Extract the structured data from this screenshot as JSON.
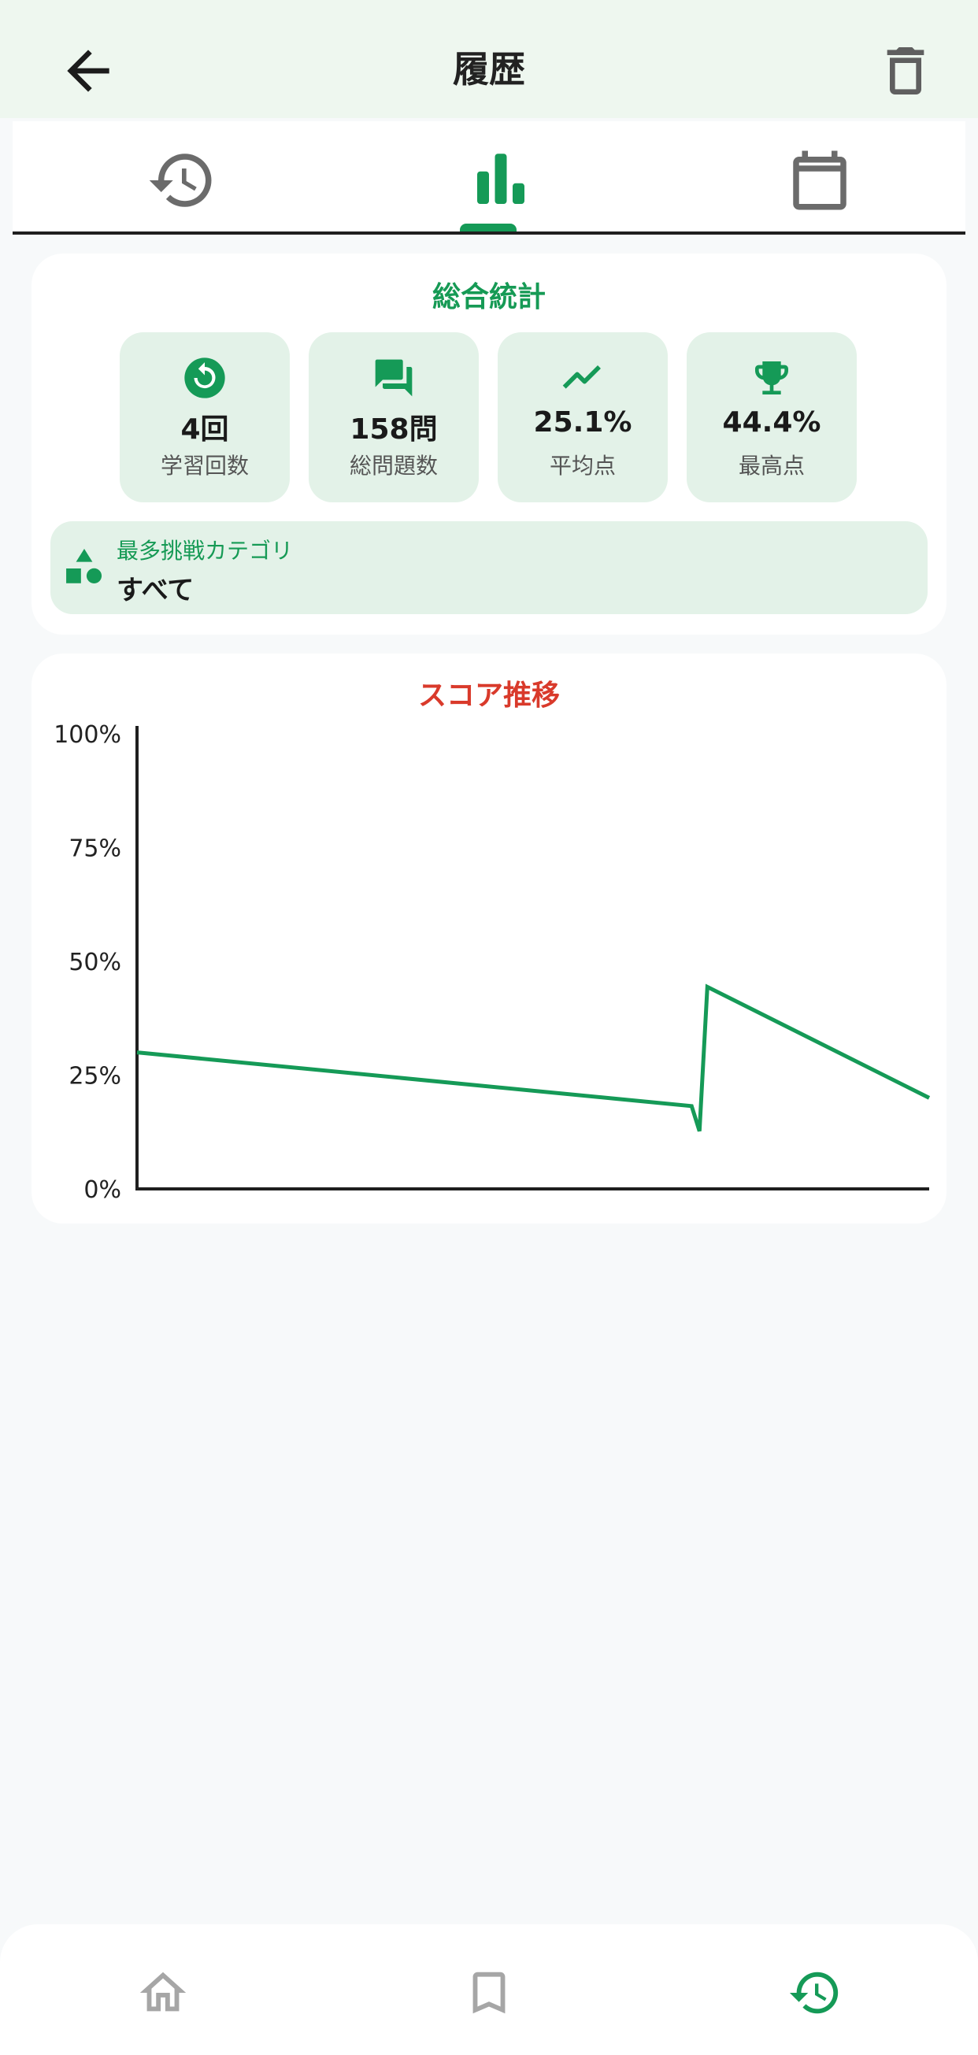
{
  "app_bar": {
    "title": "履歴",
    "back_icon": "arrow-back-icon",
    "delete_icon": "trash-icon"
  },
  "tabs": [
    {
      "name": "history",
      "icon": "history-icon",
      "active": false
    },
    {
      "name": "stats",
      "icon": "bar-chart-icon",
      "active": true
    },
    {
      "name": "calendar",
      "icon": "calendar-icon",
      "active": false
    }
  ],
  "summary": {
    "title": "総合統計",
    "stats": [
      {
        "icon": "replay-icon",
        "value": "4回",
        "label": "学習回数"
      },
      {
        "icon": "forum-icon",
        "value": "158問",
        "label": "総問題数"
      },
      {
        "icon": "trending-up-icon",
        "value": "25.1%",
        "label": "平均点"
      },
      {
        "icon": "trophy-icon",
        "value": "44.4%",
        "label": "最高点"
      }
    ],
    "top_category": {
      "icon": "category-shapes-icon",
      "label": "最多挑戦カテゴリ",
      "value": "すべて"
    }
  },
  "chart_data": {
    "type": "line",
    "title": "スコア推移",
    "y_ticks": [
      "100%",
      "75%",
      "50%",
      "25%",
      "0%"
    ],
    "ylim": [
      0,
      100
    ],
    "grid": false,
    "series": [
      {
        "x": [
          0,
          1,
          2,
          3
        ],
        "values": [
          30.0,
          12.7,
          44.4,
          20.0
        ],
        "color": "#159a57"
      }
    ]
  },
  "bottom_nav": [
    {
      "name": "home",
      "icon": "home-icon",
      "active": false
    },
    {
      "name": "bookmark",
      "icon": "bookmark-icon",
      "active": false
    },
    {
      "name": "history",
      "icon": "history-icon",
      "active": true
    }
  ],
  "colors": {
    "accent": "#159a57",
    "chart_title": "#d93a2b",
    "stat_bg": "#e3f2e8",
    "appbar_bg": "#eef7ef",
    "inactive_icon": "#6b6b6b"
  }
}
